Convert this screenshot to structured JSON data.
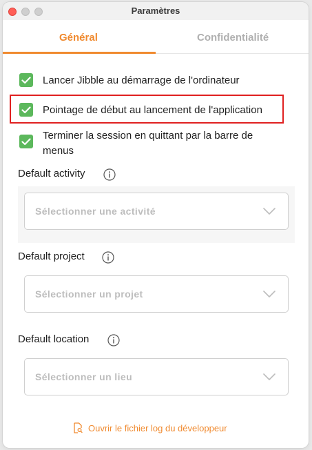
{
  "window": {
    "title": "Paramètres"
  },
  "tabs": [
    {
      "label": "Général",
      "active": true
    },
    {
      "label": "Confidentialité",
      "active": false
    }
  ],
  "checkboxes": [
    {
      "label": "Lancer Jibble au démarrage de l'ordinateur",
      "checked": true
    },
    {
      "label": "Pointage de début au lancement de l'application",
      "checked": true
    },
    {
      "label": "Terminer la session en quittant par la barre de menus",
      "checked": true
    }
  ],
  "fields": {
    "activity": {
      "label": "Default activity",
      "placeholder": "Sélectionner une activité"
    },
    "project": {
      "label": "Default project",
      "placeholder": "Sélectionner un projet"
    },
    "location": {
      "label": "Default location",
      "placeholder": "Sélectionner un lieu"
    }
  },
  "developer_log": {
    "label": "Ouvrir le fichier log du développeur"
  },
  "colors": {
    "accent": "#f08a2f",
    "checkbox": "#5cb85c",
    "highlight": "#e02020"
  }
}
